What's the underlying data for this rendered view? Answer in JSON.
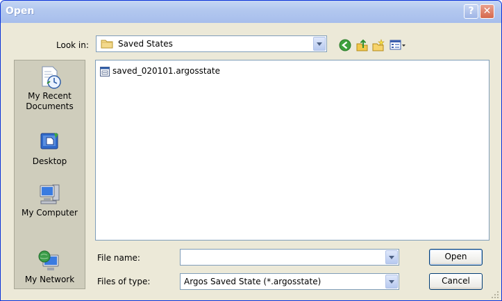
{
  "window": {
    "title": "Open"
  },
  "titlebar": {
    "help": "?",
    "close": "✕"
  },
  "lookin": {
    "label": "Look in:",
    "value": "Saved States"
  },
  "toolbar": {
    "back_icon": "back-icon",
    "up_icon": "up-folder-icon",
    "newfolder_icon": "new-folder-icon",
    "views_icon": "views-menu-icon"
  },
  "places": [
    {
      "label": "My Recent Documents",
      "icon": "recent-documents-icon"
    },
    {
      "label": "Desktop",
      "icon": "desktop-icon"
    },
    {
      "label": "My Computer",
      "icon": "my-computer-icon"
    },
    {
      "label": "My Network",
      "icon": "my-network-icon"
    }
  ],
  "files": [
    {
      "name": "saved_020101.argosstate",
      "icon": "file-icon"
    }
  ],
  "filename": {
    "label": "File name:",
    "value": ""
  },
  "filetype": {
    "label": "Files of type:",
    "value": "Argos Saved State (*.argosstate)"
  },
  "buttons": {
    "open": "Open",
    "cancel": "Cancel"
  },
  "colors": {
    "title_text": "#ffffff",
    "dialog_bg": "#ece9d8",
    "border": "#7f9db9"
  }
}
